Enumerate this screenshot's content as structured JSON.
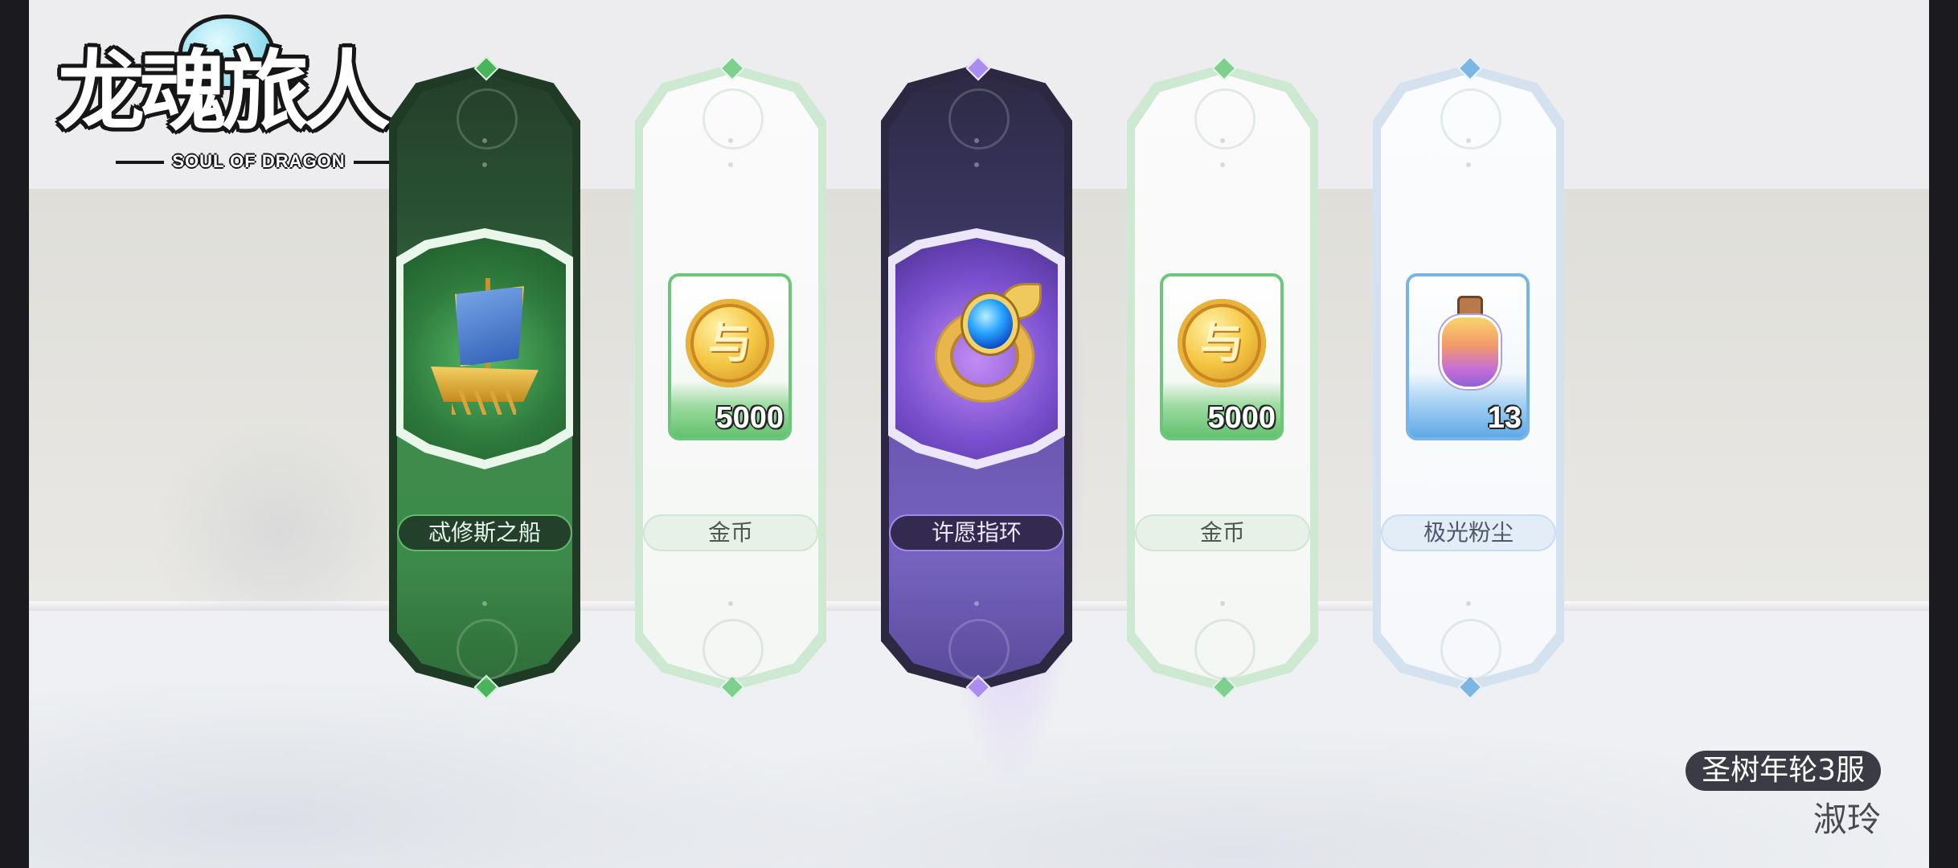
{
  "game": {
    "logo_title": "龙魂旅人",
    "logo_subtitle": "SOUL OF DRAGON"
  },
  "rewards": [
    {
      "name": "忒修斯之船",
      "rarity": "green",
      "icon": "ship-icon",
      "count": null
    },
    {
      "name": "金币",
      "rarity": "common",
      "icon": "gold-coin-icon",
      "count": "5000"
    },
    {
      "name": "许愿指环",
      "rarity": "purple",
      "icon": "wish-ring-icon",
      "count": null
    },
    {
      "name": "金币",
      "rarity": "common",
      "icon": "gold-coin-icon",
      "count": "5000"
    },
    {
      "name": "极光粉尘",
      "rarity": "blue",
      "icon": "aurora-dust-potion-icon",
      "count": "13"
    }
  ],
  "server": {
    "name": "圣树年轮3服",
    "player_name": "淑玲"
  },
  "colors": {
    "green_card": "#3f8c4d",
    "purple_card": "#6a56b0",
    "common_border": "#6cc77a",
    "blue_border": "#79b4e6",
    "server_badge": "#3b3b46"
  }
}
